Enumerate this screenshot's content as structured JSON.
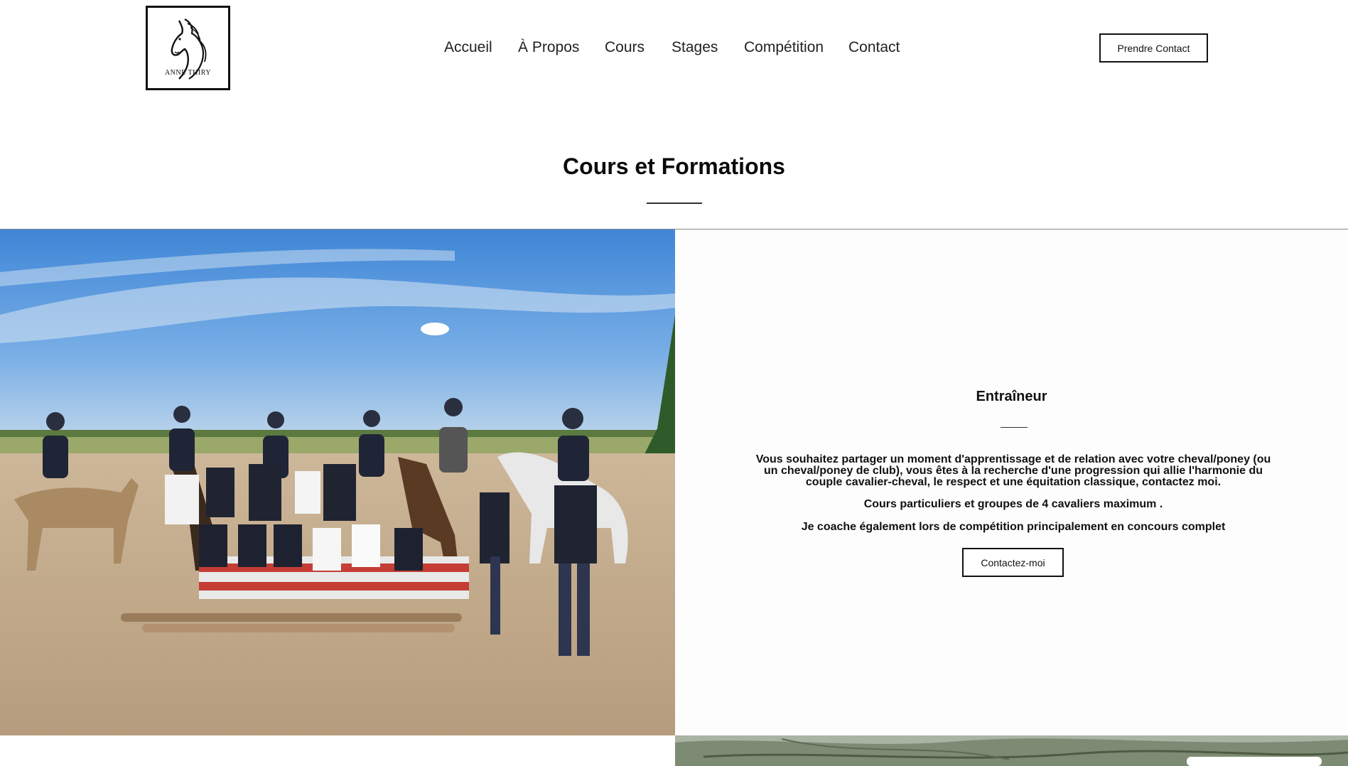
{
  "header": {
    "logo_text": "ANNE THIRY",
    "nav": [
      {
        "label": "Accueil"
      },
      {
        "label": "À Propos"
      },
      {
        "label": "Cours"
      },
      {
        "label": "Stages"
      },
      {
        "label": "Compétition"
      },
      {
        "label": "Contact"
      }
    ],
    "cta_label": "Prendre Contact"
  },
  "main": {
    "title": "Cours et Formations",
    "panel": {
      "title": "Entraîneur",
      "paragraphs": [
        "Vous souhaitez partager un moment d'apprentissage et de relation avec votre cheval/poney (ou un cheval/poney de club), vous êtes à la recherche d'une progression qui allie l'harmonie du couple cavalier-cheval, le respect et une équitation classique, contactez moi.",
        "Cours particuliers et groupes de 4 cavaliers maximum .",
        "Je coache également lors de compétition principalement en concours complet"
      ],
      "button_label": "Contactez-moi"
    }
  },
  "colors": {
    "text": "#111111",
    "background": "#ffffff",
    "sky": "#5f9fe0",
    "sand": "#c9b497"
  },
  "icons": {
    "logo": "horse-head-logo"
  }
}
